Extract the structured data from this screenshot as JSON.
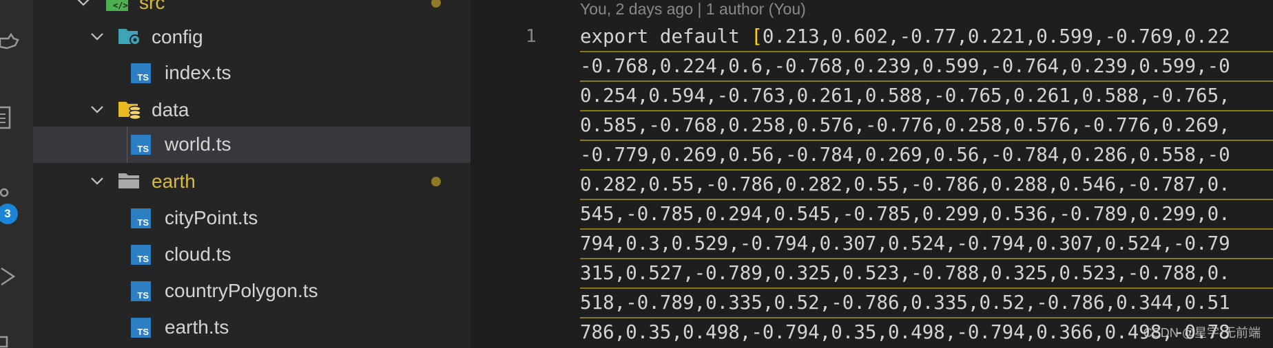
{
  "explorer": {
    "items": [
      {
        "label": "src",
        "kind": "folder",
        "modified": true
      },
      {
        "label": "config",
        "kind": "folder",
        "modified": false
      },
      {
        "label": "index.ts",
        "kind": "file",
        "badge": "TS"
      },
      {
        "label": "data",
        "kind": "folder",
        "modified": false
      },
      {
        "label": "world.ts",
        "kind": "file",
        "badge": "TS",
        "selected": true
      },
      {
        "label": "earth",
        "kind": "folder",
        "modified": true
      },
      {
        "label": "cityPoint.ts",
        "kind": "file",
        "badge": "TS"
      },
      {
        "label": "cloud.ts",
        "kind": "file",
        "badge": "TS"
      },
      {
        "label": "countryPolygon.ts",
        "kind": "file",
        "badge": "TS"
      },
      {
        "label": "earth.ts",
        "kind": "file",
        "badge": "TS"
      }
    ]
  },
  "activity_bar": {
    "badge_count": "3",
    "icons": [
      "docker-icon",
      "files-icon",
      "source-control-icon",
      "run-debug-icon",
      "extensions-icon"
    ]
  },
  "editor": {
    "blame": "You, 2 days ago | 1 author (You)",
    "line_number": "1",
    "keyword": "export default ",
    "bracket": "[",
    "lines": [
      "0.213,0.602,-0.77,0.221,0.599,-0.769,0.22",
      "-0.768,0.224,0.6,-0.768,0.239,0.599,-0.764,0.239,0.599,-0",
      "0.254,0.594,-0.763,0.261,0.588,-0.765,0.261,0.588,-0.765,",
      "0.585,-0.768,0.258,0.576,-0.776,0.258,0.576,-0.776,0.269,",
      "-0.779,0.269,0.56,-0.784,0.269,0.56,-0.784,0.286,0.558,-0",
      "0.282,0.55,-0.786,0.282,0.55,-0.786,0.288,0.546,-0.787,0.",
      "545,-0.785,0.294,0.545,-0.785,0.299,0.536,-0.789,0.299,0.",
      "794,0.3,0.529,-0.794,0.307,0.524,-0.794,0.307,0.524,-0.79",
      "315,0.527,-0.789,0.325,0.523,-0.788,0.325,0.523,-0.788,0.",
      "518,-0.789,0.335,0.52,-0.786,0.335,0.52,-0.786,0.344,0.51",
      "786,0.35,0.498,-0.794,0.35,0.498,-0.794,0.366,0.49"
    ],
    "last_line_tail": "8,-0.78"
  },
  "watermark": "CSDN @星宇-无前端",
  "colors": {
    "folder_modified_text": "#d7ba3f",
    "ts_badge": "#2d7fc4",
    "bracket": "#ffd700",
    "modified_dot": "#8f7a27",
    "line_underline": "#8b7a18"
  }
}
